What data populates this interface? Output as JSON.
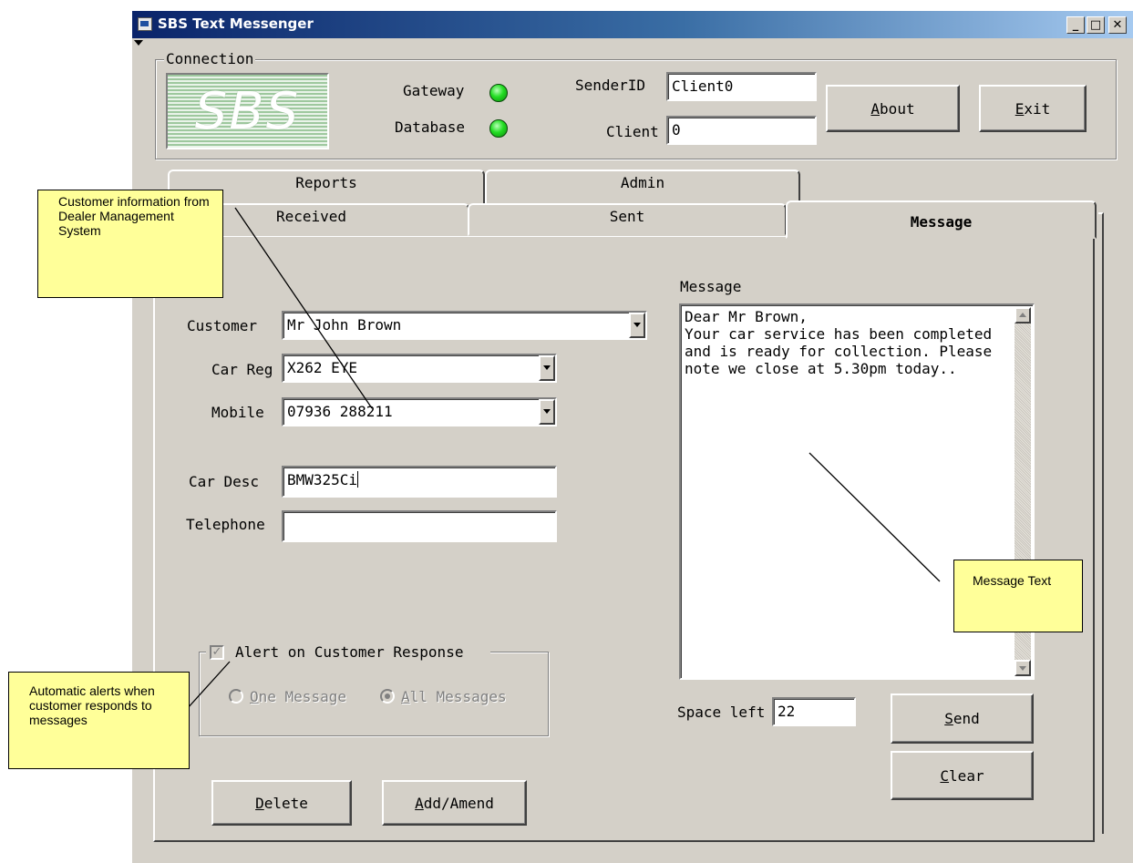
{
  "window": {
    "title": "SBS Text Messenger",
    "minimize": "_",
    "maximize": "□",
    "close": "✕"
  },
  "connection": {
    "group_label": "Connection",
    "logo_text": "SBS",
    "gateway_label": "Gateway",
    "database_label": "Database",
    "sender_id_label": "SenderID",
    "sender_id_value": "Client0",
    "client_label": "Client",
    "client_value": "0",
    "status_color": "#22dd22"
  },
  "buttons": {
    "about_u": "A",
    "about_rest": "bout",
    "exit_u": "E",
    "exit_rest": "xit",
    "send_u": "S",
    "send_rest": "end",
    "clear_u": "C",
    "clear_rest": "lear",
    "delete_u": "D",
    "delete_rest": "elete",
    "add_u": "A",
    "add_rest": "dd/Amend"
  },
  "tabs": {
    "reports": "Reports",
    "admin": "Admin",
    "received": "Received",
    "sent": "Sent",
    "message": "Message"
  },
  "form": {
    "customer_label": "Customer",
    "customer_value": "Mr John Brown",
    "car_reg_label": "Car Reg",
    "car_reg_value": "X262 EYE",
    "mobile_label": "Mobile",
    "mobile_value": "07936 288211",
    "car_desc_label": "Car Desc",
    "car_desc_value": "BMW325Ci",
    "telephone_label": "Telephone",
    "telephone_value": ""
  },
  "alerts": {
    "checkbox_label": "Alert on Customer Response",
    "one_u": "O",
    "one_rest": "ne Message",
    "all_u": "A",
    "all_rest": "ll Messages"
  },
  "message": {
    "label": "Message",
    "text": "Dear Mr Brown,\nYour car service has been completed\nand is ready for collection. Please\nnote we close at 5.30pm today..",
    "space_left_label": "Space left",
    "space_left_value": "22"
  },
  "callouts": {
    "customer_info": "Customer information from Dealer Management System",
    "message_text": "Message Text",
    "automatic_alerts": "Automatic alerts when customer responds to messages",
    "color": "#ffff99"
  }
}
